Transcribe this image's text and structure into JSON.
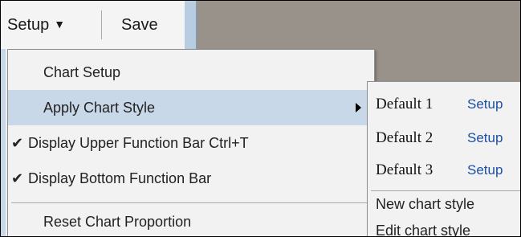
{
  "toolbar": {
    "setup_label": "Setup",
    "setup_arrow": "▼",
    "save_label": "Save"
  },
  "menu": {
    "items": [
      {
        "label": "Chart Setup",
        "checked": false
      },
      {
        "label": "Apply Chart Style",
        "has_submenu": true,
        "highlighted": true
      },
      {
        "label": "Display Upper Function Bar  Ctrl+T",
        "checked": true
      },
      {
        "label": "Display Bottom Function Bar",
        "checked": true
      },
      {
        "label": "Reset Chart Proportion",
        "checked": false
      }
    ],
    "check_glyph": "✔"
  },
  "submenu": {
    "styles": [
      {
        "name": "Default 1",
        "action": "Setup"
      },
      {
        "name": "Default 2",
        "action": "Setup"
      },
      {
        "name": "Default 3",
        "action": "Setup"
      }
    ],
    "new_label": "New chart style",
    "edit_label": "Edit chart style"
  },
  "colors": {
    "highlight": "#c8d8e8",
    "link": "#1b4fa3",
    "background_dark": "#99928a"
  }
}
